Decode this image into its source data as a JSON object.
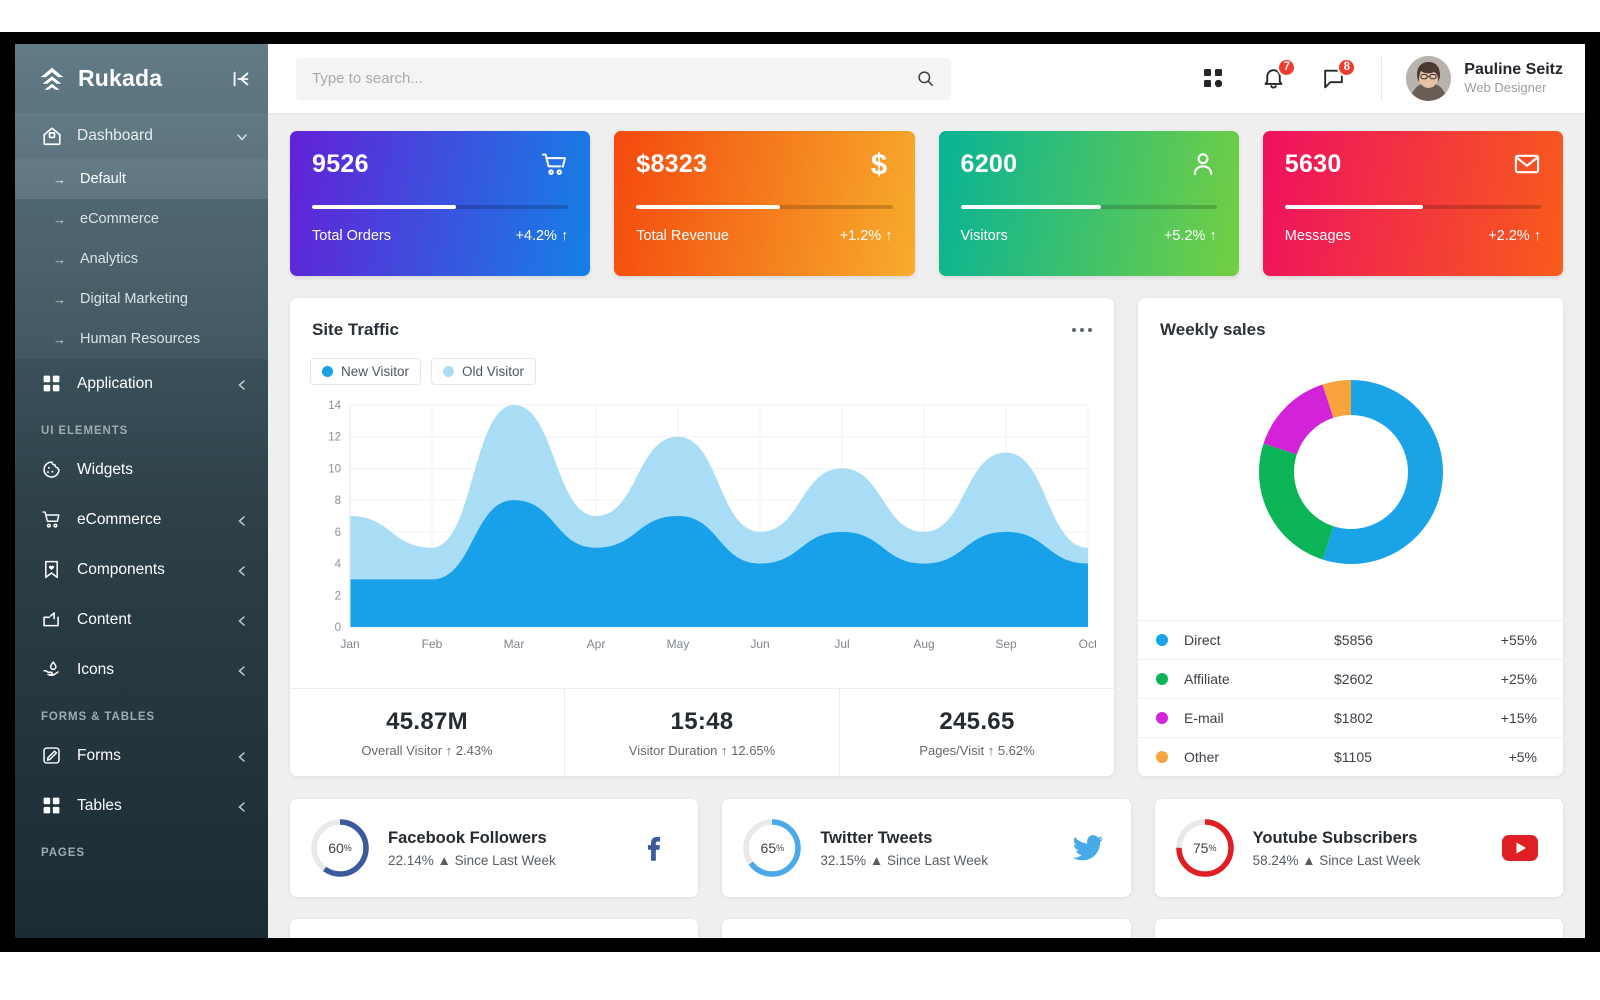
{
  "brand": {
    "name": "Rukada",
    "logo_icon": "chevron-stack-logo",
    "collapse_icon": "collapse-sidebar-icon"
  },
  "sidebar": {
    "dashboard": {
      "label": "Dashboard",
      "icon": "home-icon",
      "caret": "chevron-down-icon"
    },
    "dashboard_children": [
      {
        "label": "Default",
        "active": true
      },
      {
        "label": "eCommerce",
        "active": false
      },
      {
        "label": "Analytics",
        "active": false
      },
      {
        "label": "Digital Marketing",
        "active": false
      },
      {
        "label": "Human Resources",
        "active": false
      }
    ],
    "application": {
      "label": "Application",
      "icon": "grid-icon",
      "caret": "chevron-left-icon"
    },
    "section_ui": "UI ELEMENTS",
    "ui_items": [
      {
        "label": "Widgets",
        "icon": "cookie-icon",
        "caret": ""
      },
      {
        "label": "eCommerce",
        "icon": "cart-icon",
        "caret": "chevron-left-icon"
      },
      {
        "label": "Components",
        "icon": "bookmark-heart-icon",
        "caret": "chevron-left-icon"
      },
      {
        "label": "Content",
        "icon": "content-box-icon",
        "caret": "chevron-left-icon"
      },
      {
        "label": "Icons",
        "icon": "hand-drop-icon",
        "caret": "chevron-left-icon"
      }
    ],
    "section_forms": "FORMS & TABLES",
    "forms_items": [
      {
        "label": "Forms",
        "icon": "edit-square-icon",
        "caret": "chevron-left-icon"
      },
      {
        "label": "Tables",
        "icon": "grid-icon",
        "caret": "chevron-left-icon"
      }
    ],
    "section_pages": "PAGES"
  },
  "topbar": {
    "search_placeholder": "Type to search...",
    "search_value": "",
    "search_icon": "search-icon",
    "apps_icon": "apps-grid-icon",
    "bell_icon": "bell-icon",
    "bell_count": "7",
    "chat_icon": "chat-bubble-icon",
    "chat_count": "8",
    "user_name": "Pauline Seitz",
    "user_role": "Web Designer",
    "badge_color": "#f03b2d"
  },
  "stats": [
    {
      "value": "9526",
      "label": "Total Orders",
      "delta": "+4.2%",
      "icon": "cart-icon",
      "progress": 56,
      "c1": "#6321d6",
      "c2": "#1580e6"
    },
    {
      "value": "$8323",
      "label": "Total Revenue",
      "delta": "+1.2%",
      "icon": "dollar-icon",
      "progress": 56,
      "c1": "#f4490e",
      "c2": "#f6ad2c"
    },
    {
      "value": "6200",
      "label": "Visitors",
      "delta": "+5.2%",
      "icon": "user-icon",
      "progress": 55,
      "c1": "#08b397",
      "c2": "#73cf42"
    },
    {
      "value": "5630",
      "label": "Messages",
      "delta": "+2.2%",
      "icon": "envelope-icon",
      "progress": 54,
      "c1": "#ee1060",
      "c2": "#f85c1b"
    }
  ],
  "traffic": {
    "title": "Site Traffic",
    "menu_icon": "more-horizontal-icon",
    "stats": [
      {
        "value": "45.87M",
        "label": "Overall Visitor ↑ 2.43%"
      },
      {
        "value": "15:48",
        "label": "Visitor Duration ↑ 12.65%"
      },
      {
        "value": "245.65",
        "label": "Pages/Visit ↑ 5.62%"
      }
    ]
  },
  "sales": {
    "title": "Weekly sales",
    "rows": [
      {
        "name": "Direct",
        "amount": "$5856",
        "percent": "+55%",
        "color": "#1ba3e8"
      },
      {
        "name": "Affiliate",
        "amount": "$2602",
        "percent": "+25%",
        "color": "#0ab457"
      },
      {
        "name": "E-mail",
        "amount": "$1802",
        "percent": "+15%",
        "color": "#d223d9"
      },
      {
        "name": "Other",
        "amount": "$1105",
        "percent": "+5%",
        "color": "#f9a33c"
      }
    ]
  },
  "social": [
    {
      "percent": "60",
      "unit": "%",
      "title": "Facebook Followers",
      "sub": "22.14% ▲ Since Last Week",
      "color": "#3b5a9b",
      "icon": "facebook-icon",
      "value": 60
    },
    {
      "percent": "65",
      "unit": "%",
      "title": "Twitter Tweets",
      "sub": "32.15% ▲ Since Last Week",
      "color": "#4aa9e8",
      "icon": "twitter-icon",
      "value": 65
    },
    {
      "percent": "75",
      "unit": "%",
      "title": "Youtube Subscribers",
      "sub": "58.24% ▲ Since Last Week",
      "color": "#e01f25",
      "icon": "youtube-icon",
      "value": 75
    }
  ],
  "chart_data": [
    {
      "type": "area",
      "title": "Site Traffic",
      "xlabel": "",
      "ylabel": "",
      "grid": true,
      "legend_position": "top-left",
      "ylim": [
        0,
        14
      ],
      "yticks": [
        0,
        2,
        4,
        6,
        8,
        10,
        12,
        14
      ],
      "categories": [
        "Jan",
        "Feb",
        "Mar",
        "Apr",
        "May",
        "Jun",
        "Jul",
        "Aug",
        "Sep",
        "Oct"
      ],
      "series": [
        {
          "name": "New Visitor",
          "color": "#18a0e8",
          "values": [
            3,
            3,
            8,
            5,
            7,
            4,
            6,
            4,
            6,
            4
          ]
        },
        {
          "name": "Old Visitor",
          "color": "#a9ddf5",
          "values": [
            7,
            5,
            14,
            7,
            12,
            6,
            10,
            6,
            11,
            5
          ]
        }
      ]
    },
    {
      "type": "pie",
      "title": "Weekly sales",
      "labels": [
        "Direct",
        "Affiliate",
        "E-mail",
        "Other"
      ],
      "values": [
        55,
        25,
        15,
        5
      ],
      "amounts": [
        "$5856",
        "$2602",
        "$1802",
        "$1105"
      ],
      "colors": [
        "#1ba3e8",
        "#0ab457",
        "#d223d9",
        "#f9a33c"
      ],
      "legend_position": "bottom",
      "donut": true
    },
    {
      "type": "pie",
      "title": "Facebook Followers",
      "labels": [
        "Facebook Followers"
      ],
      "values": [
        60
      ],
      "colors": [
        "#3b5a9b"
      ],
      "donut": true
    },
    {
      "type": "pie",
      "title": "Twitter Tweets",
      "labels": [
        "Twitter Tweets"
      ],
      "values": [
        65
      ],
      "colors": [
        "#4aa9e8"
      ],
      "donut": true
    },
    {
      "type": "pie",
      "title": "Youtube Subscribers",
      "labels": [
        "Youtube Subscribers"
      ],
      "values": [
        75
      ],
      "colors": [
        "#e01f25"
      ],
      "donut": true
    }
  ]
}
